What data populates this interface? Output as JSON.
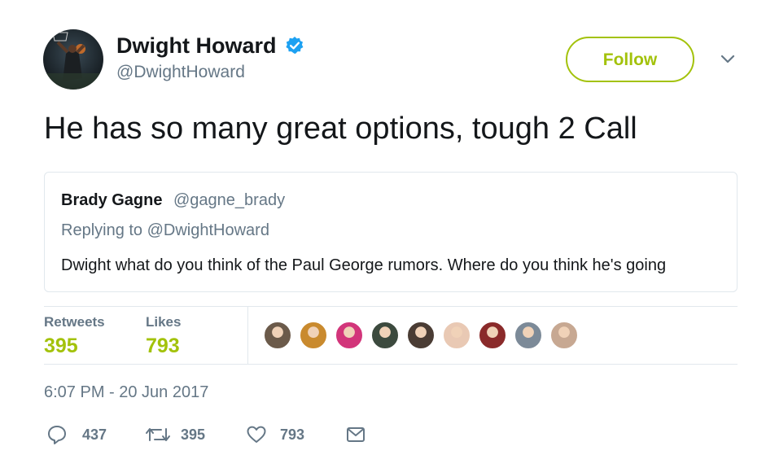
{
  "header": {
    "display_name": "Dwight Howard",
    "handle": "@DwightHoward",
    "follow_label": "Follow",
    "verified": true
  },
  "tweet": {
    "text": "He has so many great options, tough 2 Call"
  },
  "quoted": {
    "name": "Brady Gagne",
    "handle": "@gagne_brady",
    "replying_to": "Replying to @DwightHoward",
    "text": "Dwight what do you think of the Paul George rumors. Where do you think he's going"
  },
  "stats": {
    "retweets_label": "Retweets",
    "retweets_value": "395",
    "likes_label": "Likes",
    "likes_value": "793"
  },
  "likers": [
    "#6b5a4a",
    "#c98a2e",
    "#d2357a",
    "#3c4a3e",
    "#4a3c34",
    "#e9c9b4",
    "#8a2a2a",
    "#7c8a98",
    "#c7a892"
  ],
  "timestamp": "6:07 PM - 20 Jun 2017",
  "actions": {
    "reply_count": "437",
    "retweet_count": "395",
    "like_count": "793"
  },
  "colors": {
    "accent": "#a3c20b",
    "secondary_text": "#657786",
    "verified_blue": "#1da1f2",
    "border": "#e1e8ed"
  },
  "icons": [
    "verified-badge-icon",
    "chevron-down-icon",
    "reply-icon",
    "retweet-icon",
    "heart-icon",
    "message-icon"
  ]
}
